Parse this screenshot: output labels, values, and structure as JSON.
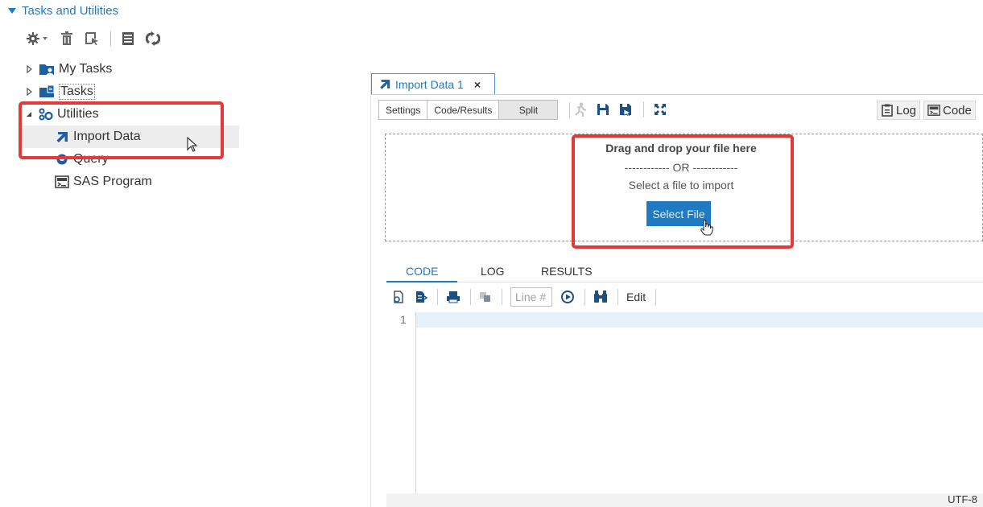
{
  "left_panel": {
    "section_title": "Tasks and Utilities",
    "toolbar": [
      "new-task-icon",
      "delete-icon",
      "open-icon",
      "properties-icon",
      "refresh-icon"
    ],
    "tree": [
      {
        "label": "My Tasks",
        "icon": "folder-user-icon",
        "expanded": false
      },
      {
        "label": "Tasks",
        "icon": "folder-tasks-icon",
        "expanded": false
      },
      {
        "label": "Utilities",
        "icon": "utilities-icon",
        "expanded": true
      },
      {
        "label": "Import Data",
        "icon": "import-icon",
        "selected": true
      },
      {
        "label": "Query",
        "icon": "query-icon"
      },
      {
        "label": "SAS Program",
        "icon": "sas-program-icon"
      }
    ]
  },
  "editor": {
    "tab_label": "Import Data 1",
    "tab_close": "×",
    "view_modes": [
      "Settings",
      "Code/Results",
      "Split"
    ],
    "log_button": "Log",
    "code_button": "Code"
  },
  "dropzone": {
    "heading": "Drag and drop your file here",
    "or_text": "------------ OR ------------",
    "subtext": "Select a file to import",
    "button": "Select File"
  },
  "bottom_tabs": {
    "items": [
      "CODE",
      "LOG",
      "RESULTS"
    ],
    "active": "CODE"
  },
  "code_toolbar": {
    "line_placeholder": "Line #",
    "edit_label": "Edit"
  },
  "code_editor": {
    "line_numbers": [
      "1"
    ]
  },
  "status": {
    "encoding": "UTF-8"
  },
  "colors": {
    "accent": "#1f7ac2",
    "highlight_box": "#e23a3a",
    "selected_row": "#ededed"
  }
}
